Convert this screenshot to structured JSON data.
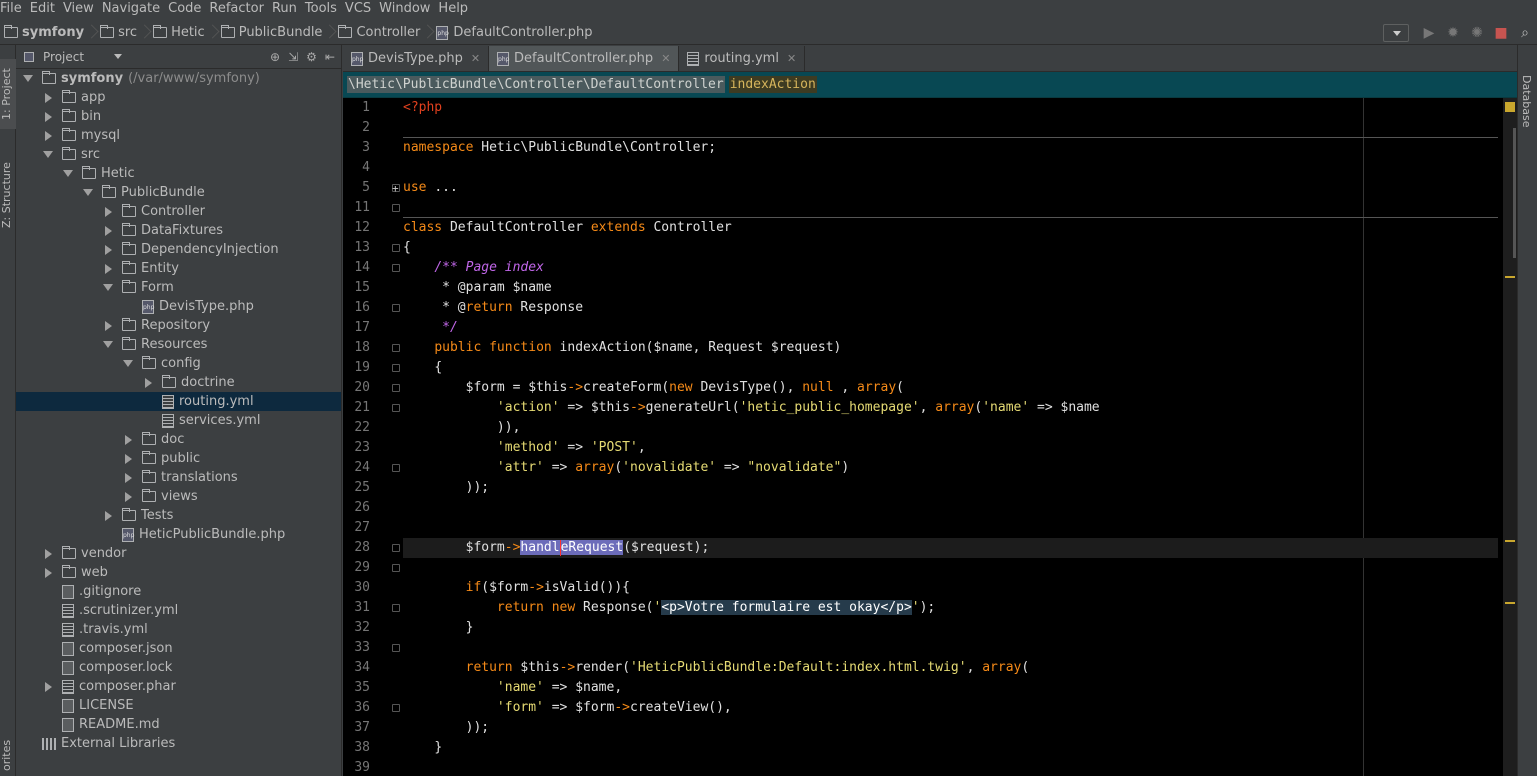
{
  "menubar": {
    "items": [
      "File",
      "Edit",
      "View",
      "Navigate",
      "Code",
      "Refactor",
      "Run",
      "Tools",
      "VCS",
      "Window",
      "Help"
    ]
  },
  "navbar": {
    "crumbs": [
      "symfony",
      "src",
      "Hetic",
      "PublicBundle",
      "Controller",
      "DefaultController.php"
    ]
  },
  "leftstrip": {
    "project": "1: Project",
    "structure": "Z: Structure",
    "favorites": "orites"
  },
  "rightstrip": {
    "database": "Database"
  },
  "project_panel": {
    "title": "Project",
    "tree": [
      {
        "label": "symfony",
        "extra": "(/var/www/symfony)",
        "depth": 0,
        "arrow": "down",
        "icon": "folder",
        "bold": true
      },
      {
        "label": "app",
        "depth": 1,
        "arrow": "right",
        "icon": "folder"
      },
      {
        "label": "bin",
        "depth": 1,
        "arrow": "right",
        "icon": "folder"
      },
      {
        "label": "mysql",
        "depth": 1,
        "arrow": "right",
        "icon": "folder"
      },
      {
        "label": "src",
        "depth": 1,
        "arrow": "down",
        "icon": "folder"
      },
      {
        "label": "Hetic",
        "depth": 2,
        "arrow": "down",
        "icon": "folder"
      },
      {
        "label": "PublicBundle",
        "depth": 3,
        "arrow": "down",
        "icon": "folder"
      },
      {
        "label": "Controller",
        "depth": 4,
        "arrow": "right",
        "icon": "folder"
      },
      {
        "label": "DataFixtures",
        "depth": 4,
        "arrow": "right",
        "icon": "folder"
      },
      {
        "label": "DependencyInjection",
        "depth": 4,
        "arrow": "right",
        "icon": "folder"
      },
      {
        "label": "Entity",
        "depth": 4,
        "arrow": "right",
        "icon": "folder"
      },
      {
        "label": "Form",
        "depth": 4,
        "arrow": "down",
        "icon": "folder"
      },
      {
        "label": "DevisType.php",
        "depth": 5,
        "arrow": "none",
        "icon": "php"
      },
      {
        "label": "Repository",
        "depth": 4,
        "arrow": "right",
        "icon": "folder"
      },
      {
        "label": "Resources",
        "depth": 4,
        "arrow": "down",
        "icon": "folder"
      },
      {
        "label": "config",
        "depth": 5,
        "arrow": "down",
        "icon": "folder"
      },
      {
        "label": "doctrine",
        "depth": 6,
        "arrow": "right",
        "icon": "folder"
      },
      {
        "label": "routing.yml",
        "depth": 6,
        "arrow": "none",
        "icon": "yml",
        "selected": true
      },
      {
        "label": "services.yml",
        "depth": 6,
        "arrow": "none",
        "icon": "yml"
      },
      {
        "label": "doc",
        "depth": 5,
        "arrow": "right",
        "icon": "folder"
      },
      {
        "label": "public",
        "depth": 5,
        "arrow": "right",
        "icon": "folder"
      },
      {
        "label": "translations",
        "depth": 5,
        "arrow": "right",
        "icon": "folder"
      },
      {
        "label": "views",
        "depth": 5,
        "arrow": "right",
        "icon": "folder"
      },
      {
        "label": "Tests",
        "depth": 4,
        "arrow": "right",
        "icon": "folder"
      },
      {
        "label": "HeticPublicBundle.php",
        "depth": 4,
        "arrow": "none",
        "icon": "php"
      },
      {
        "label": "vendor",
        "depth": 1,
        "arrow": "right",
        "icon": "folder"
      },
      {
        "label": "web",
        "depth": 1,
        "arrow": "right",
        "icon": "folder"
      },
      {
        "label": ".gitignore",
        "depth": 1,
        "arrow": "none",
        "icon": "file"
      },
      {
        "label": ".scrutinizer.yml",
        "depth": 1,
        "arrow": "none",
        "icon": "yml"
      },
      {
        "label": ".travis.yml",
        "depth": 1,
        "arrow": "none",
        "icon": "yml"
      },
      {
        "label": "composer.json",
        "depth": 1,
        "arrow": "none",
        "icon": "file"
      },
      {
        "label": "composer.lock",
        "depth": 1,
        "arrow": "none",
        "icon": "file"
      },
      {
        "label": "composer.phar",
        "depth": 1,
        "arrow": "right",
        "icon": "yml"
      },
      {
        "label": "LICENSE",
        "depth": 1,
        "arrow": "none",
        "icon": "file"
      },
      {
        "label": "README.md",
        "depth": 1,
        "arrow": "none",
        "icon": "file"
      },
      {
        "label": "External Libraries",
        "depth": 0,
        "arrow": "none",
        "icon": "lib"
      }
    ]
  },
  "editor": {
    "tabs": [
      {
        "label": "DevisType.php",
        "icon": "php",
        "active": false
      },
      {
        "label": "DefaultController.php",
        "icon": "php",
        "active": true
      },
      {
        "label": "routing.yml",
        "icon": "yml",
        "active": false
      }
    ],
    "breadcrumb_ns": "\\Hetic\\PublicBundle\\Controller\\DefaultController",
    "breadcrumb_method": "indexAction",
    "line_numbers": [
      "1",
      "2",
      "3",
      "4",
      "5",
      "11",
      "12",
      "13",
      "14",
      "15",
      "16",
      "17",
      "18",
      "19",
      "20",
      "21",
      "22",
      "23",
      "24",
      "25",
      "26",
      "27",
      "28",
      "29",
      "30",
      "31",
      "32",
      "33",
      "34",
      "35",
      "36",
      "37",
      "38",
      "39"
    ],
    "code_lines": [
      "<?php",
      "",
      "namespace Hetic\\PublicBundle\\Controller;",
      "",
      "use ...",
      "",
      "class DefaultController extends Controller",
      "{",
      "    /** Page index",
      "     * @param $name",
      "     * @return Response",
      "     */",
      "    public function indexAction($name, Request $request)",
      "    {",
      "        $form = $this->createForm(new DevisType(), null , array(",
      "            'action' => $this->generateUrl('hetic_public_homepage', array('name' => $name",
      "            )),",
      "            'method' => 'POST',",
      "            'attr' => array('novalidate' => \"novalidate\")",
      "        ));",
      "",
      "",
      "        $form->handleRequest($request);",
      "",
      "        if($form->isValid()){",
      "            return new Response('<p>Votre formulaire est okay</p>');",
      "        }",
      "",
      "        return $this->render('HeticPublicBundle:Default:index.html.twig', array(",
      "            'name' => $name,",
      "            'form' => $form->createView(),",
      "        ));",
      "    }",
      ""
    ]
  }
}
